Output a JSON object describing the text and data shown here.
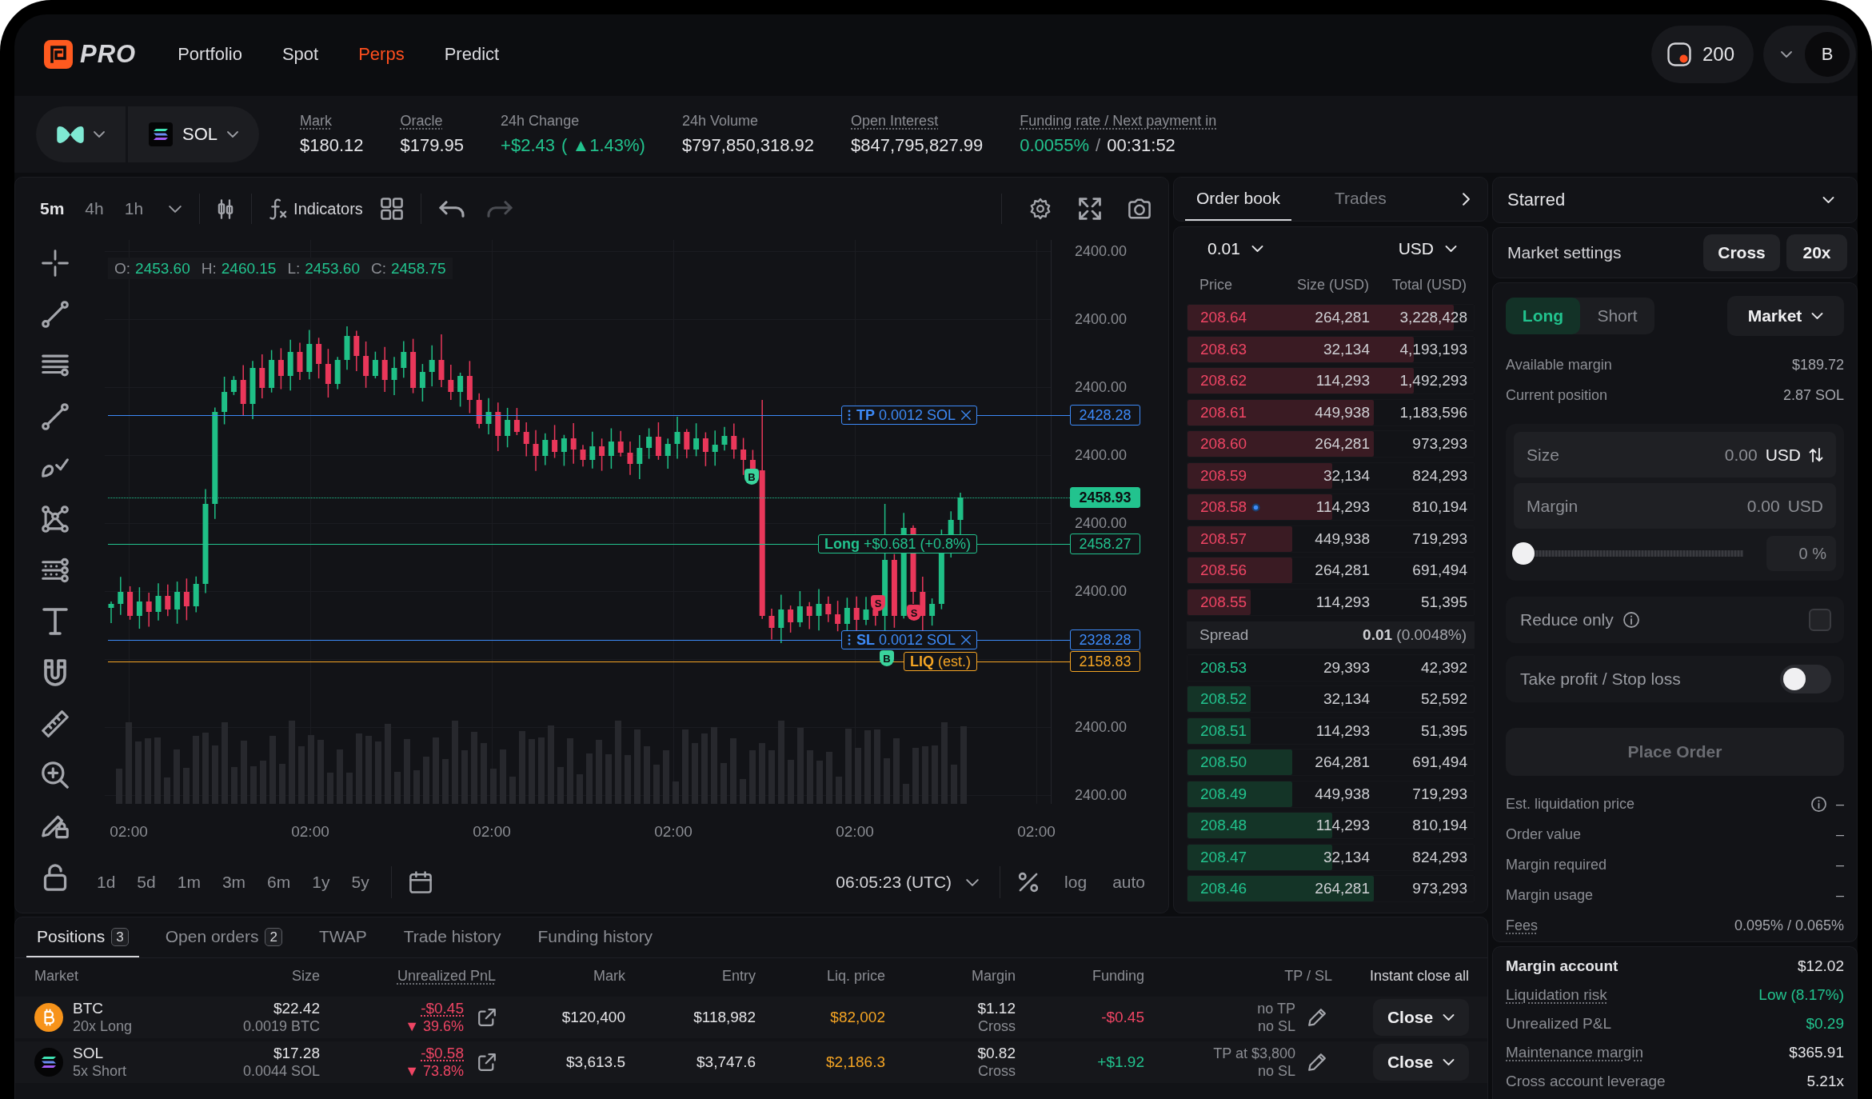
{
  "nav": {
    "logo": "PRO",
    "items": [
      {
        "label": "Portfolio",
        "selected": false
      },
      {
        "label": "Spot",
        "selected": false
      },
      {
        "label": "Perps",
        "selected": true
      },
      {
        "label": "Predict",
        "selected": false
      }
    ],
    "points": "200",
    "avatar": "B"
  },
  "ticker": {
    "market": "SOL",
    "stats": [
      {
        "label": "Mark",
        "underlined": true,
        "values": [
          {
            "text": "$180.12",
            "kind": "neutral"
          }
        ]
      },
      {
        "label": "Oracle",
        "underlined": true,
        "values": [
          {
            "text": "$179.95",
            "kind": "neutral"
          }
        ]
      },
      {
        "label": "24h Change",
        "underlined": false,
        "values": [
          {
            "text": "+$2.43",
            "kind": "positive"
          },
          {
            "text": "( ▲1.43%)",
            "kind": "positive"
          }
        ]
      },
      {
        "label": "24h Volume",
        "underlined": false,
        "values": [
          {
            "text": "$797,850,318.92",
            "kind": "neutral"
          }
        ]
      },
      {
        "label": "Open Interest",
        "underlined": true,
        "values": [
          {
            "text": "$847,795,827.99",
            "kind": "neutral"
          }
        ]
      },
      {
        "label": "Funding rate / Next payment in",
        "underlined": true,
        "values": [
          {
            "text": "0.0055%",
            "kind": "positive"
          },
          {
            "text": "/",
            "kind": "muted"
          },
          {
            "text": "00:31:52",
            "kind": "neutral"
          }
        ]
      }
    ]
  },
  "chart": {
    "intervals": [
      {
        "label": "5m",
        "selected": true
      },
      {
        "label": "4h",
        "selected": false
      },
      {
        "label": "1h",
        "selected": false
      }
    ],
    "indicators_label": "Indicators",
    "undo": {
      "disabled": false
    },
    "redo": {
      "disabled": true
    },
    "ohlc": [
      {
        "key": "O:",
        "value": "2453.60"
      },
      {
        "key": "H:",
        "value": "2460.15"
      },
      {
        "key": "L:",
        "value": "2453.60"
      },
      {
        "key": "C:",
        "value": "2458.75"
      }
    ],
    "price_axis": [
      "2400.00",
      "2400.00",
      "2400.00",
      "2400.00",
      "2400.00",
      "2400.00",
      "2400.00",
      "2400.00"
    ],
    "order_lines": [
      {
        "kind": "take_profit",
        "text": "**TP** 0.0012 SOL",
        "editable": true,
        "price": "2428.28"
      },
      {
        "kind": "last_price",
        "price": "2458.93"
      },
      {
        "kind": "position",
        "text": "**Long** +$0.681 (+0.8%)",
        "editable": false,
        "price": "2458.27"
      },
      {
        "kind": "stop_loss",
        "text": "**SL** 0.0012 SOL",
        "editable": true,
        "price": "2328.28"
      },
      {
        "kind": "liquidation",
        "text": "**LIQ** (est.)",
        "editable": false,
        "price": "2158.83"
      }
    ],
    "trade_markers": [
      {
        "kind": "buy",
        "label": "B"
      },
      {
        "kind": "sell",
        "label": "S"
      },
      {
        "kind": "sell",
        "label": "S"
      },
      {
        "kind": "buy",
        "label": "B"
      }
    ],
    "time_axis": [
      "02:00",
      "02:00",
      "02:00",
      "02:00",
      "02:00",
      "02:00"
    ],
    "ranges": [
      "1d",
      "5d",
      "1m",
      "3m",
      "6m",
      "1y",
      "5y"
    ],
    "clock": "06:05:23 (UTC)",
    "scale_options": [
      "log",
      "auto"
    ]
  },
  "order_book": {
    "tabs": [
      {
        "label": "Order book",
        "selected": true
      },
      {
        "label": "Trades",
        "selected": false
      }
    ],
    "tick_size": "0.01",
    "currency": "USD",
    "columns": [
      "Price",
      "Size (USD)",
      "Total (USD)"
    ],
    "asks": [
      {
        "price": "208.64",
        "size": "264,281",
        "total": "3,228,428",
        "level": 0.93,
        "my_order": false
      },
      {
        "price": "208.63",
        "size": "32,134",
        "total": "4,193,193",
        "level": 0.79,
        "my_order": false
      },
      {
        "price": "208.62",
        "size": "114,293",
        "total": "1,492,293",
        "level": 0.79,
        "my_order": false
      },
      {
        "price": "208.61",
        "size": "449,938",
        "total": "1,183,596",
        "level": 0.65,
        "my_order": false
      },
      {
        "price": "208.60",
        "size": "264,281",
        "total": "973,293",
        "level": 0.65,
        "my_order": false
      },
      {
        "price": "208.59",
        "size": "32,134",
        "total": "824,293",
        "level": 0.505,
        "my_order": false
      },
      {
        "price": "208.58",
        "size": "114,293",
        "total": "810,194",
        "level": 0.505,
        "my_order": true
      },
      {
        "price": "208.57",
        "size": "449,938",
        "total": "719,293",
        "level": 0.365,
        "my_order": false
      },
      {
        "price": "208.56",
        "size": "264,281",
        "total": "691,494",
        "level": 0.365,
        "my_order": false
      },
      {
        "price": "208.55",
        "size": "114,293",
        "total": "51,395",
        "level": 0.22,
        "my_order": false
      }
    ],
    "spread": {
      "label": "Spread",
      "value": "**0.01** (0.0048%)"
    },
    "bids": [
      {
        "price": "208.53",
        "size": "29,393",
        "total": "42,392",
        "my_order": false
      },
      {
        "price": "208.52",
        "size": "32,134",
        "total": "52,592",
        "level": 0.22,
        "my_order": false
      },
      {
        "price": "208.51",
        "size": "114,293",
        "total": "51,395",
        "level": 0.22,
        "my_order": false
      },
      {
        "price": "208.50",
        "size": "264,281",
        "total": "691,494",
        "level": 0.365,
        "my_order": false
      },
      {
        "price": "208.49",
        "size": "449,938",
        "total": "719,293",
        "level": 0.365,
        "my_order": false
      },
      {
        "price": "208.48",
        "size": "114,293",
        "total": "810,194",
        "level": 0.505,
        "my_order": false
      },
      {
        "price": "208.47",
        "size": "32,134",
        "total": "824,293",
        "level": 0.505,
        "my_order": false
      },
      {
        "price": "208.46",
        "size": "264,281",
        "total": "973,293",
        "level": 0.65,
        "my_order": false
      }
    ]
  },
  "order_form": {
    "starred_label": "Starred",
    "settings_label": "Market settings",
    "margin_mode": "Cross",
    "leverage": "20x",
    "sides": [
      {
        "label": "Long",
        "selected": true
      },
      {
        "label": "Short",
        "selected": false
      }
    ],
    "order_type": "Market",
    "account_rows": [
      {
        "label": "Available margin",
        "value": "$189.72"
      },
      {
        "label": "Current position",
        "value": "2.87 SOL"
      }
    ],
    "size_field": {
      "label": "Size",
      "placeholder": "0.00",
      "unit": "USD",
      "switchable": true
    },
    "margin_field": {
      "label": "Margin",
      "placeholder": "0.00",
      "unit": "USD",
      "switchable": false
    },
    "slider": {
      "level": 0,
      "placeholder": "0 %"
    },
    "reduce_only": {
      "label": "Reduce only",
      "info": true,
      "checked": false
    },
    "tpsl": {
      "label": "Take profit / Stop loss",
      "on": false
    },
    "submit": {
      "label": "Place Order",
      "disabled": true
    },
    "summary": [
      {
        "label": "Est. liquidation price",
        "value": "–",
        "info": true,
        "underlined": false
      },
      {
        "label": "Order value",
        "value": "–",
        "info": false,
        "underlined": false
      },
      {
        "label": "Margin required",
        "value": "–",
        "info": false,
        "underlined": false
      },
      {
        "label": "Margin usage",
        "value": "–",
        "info": false,
        "underlined": false
      },
      {
        "label": "Fees",
        "value": "0.095% / 0.065%",
        "info": false,
        "underlined": true
      }
    ]
  },
  "margin_account": {
    "rows": [
      {
        "kind": "heading",
        "label": "Margin account",
        "value": "$12.02",
        "underlined": false,
        "positive": false
      },
      {
        "kind": "row",
        "label": "Liquidation risk",
        "value": "Low (8.17%)",
        "underlined": true,
        "positive": true
      },
      {
        "kind": "row",
        "label": "Unrealized P&L",
        "value": "$0.29",
        "underlined": false,
        "positive": true
      },
      {
        "kind": "row",
        "label": "Maintenance margin",
        "value": "$365.91",
        "underlined": true,
        "positive": false
      },
      {
        "kind": "row",
        "label": "Cross account leverage",
        "value": "5.21x",
        "underlined": false,
        "positive": false
      }
    ]
  },
  "positions": {
    "tabs": [
      {
        "label": "Positions",
        "count": "3",
        "selected": true
      },
      {
        "label": "Open orders",
        "count": "2",
        "selected": false
      },
      {
        "label": "TWAP",
        "selected": false
      },
      {
        "label": "Trade history",
        "selected": false
      },
      {
        "label": "Funding history",
        "selected": false
      }
    ],
    "columns": [
      {
        "label": "Market",
        "underlined": false
      },
      {
        "label": "Size",
        "underlined": false
      },
      {
        "label": "Unrealized PnL",
        "underlined": true
      },
      {
        "label": "Mark",
        "underlined": false
      },
      {
        "label": "Entry",
        "underlined": false
      },
      {
        "label": "Liq. price",
        "underlined": false
      },
      {
        "label": "Margin",
        "underlined": false
      },
      {
        "label": "Funding",
        "underlined": false
      },
      {
        "label": "TP / SL",
        "underlined": false
      }
    ],
    "close_all": "Instant close all",
    "rows": [
      {
        "kind": "btc",
        "coin": "BTC",
        "side": "20x Long",
        "size": "$22.42",
        "amount": "0.0019 BTC",
        "pnl": "-$0.45",
        "pnl_pct": "▼ 39.6%",
        "pnl_negative": true,
        "mark": "$120,400",
        "entry": "$118,982",
        "liq": "$82,002",
        "margin": "$1.12",
        "margin_mode": "Cross",
        "funding": "-$0.45",
        "funding_negative": true,
        "tp": "no TP",
        "sl": "no SL",
        "action": "Close"
      },
      {
        "kind": "sol",
        "coin": "SOL",
        "side": "5x Short",
        "size": "$17.28",
        "amount": "0.0044 SOL",
        "pnl": "-$0.58",
        "pnl_pct": "▼ 73.8%",
        "pnl_negative": true,
        "mark": "$3,613.5",
        "entry": "$3,747.6",
        "liq": "$2,186.3",
        "margin": "$0.82",
        "margin_mode": "Cross",
        "funding": "+$1.92",
        "funding_negative": false,
        "tp": "TP at $3,800",
        "sl": "no SL",
        "action": "Close"
      }
    ]
  }
}
